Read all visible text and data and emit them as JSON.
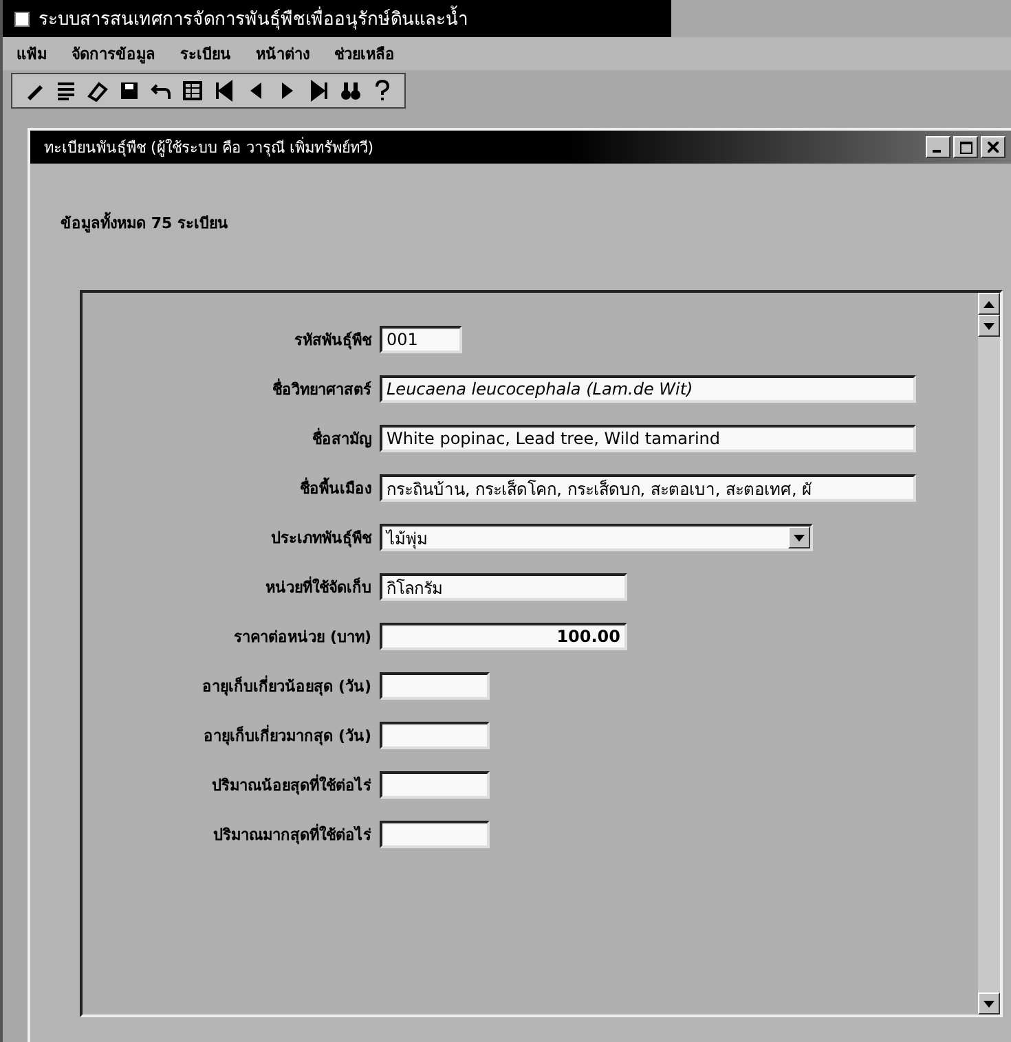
{
  "window": {
    "title": "ระบบสารสนเทศการจัดการพันธุ์พืชเพื่ออนุรักษ์ดินและน้ำ"
  },
  "menu": [
    "แฟ้ม",
    "จัดการข้อมูล",
    "ระเบียน",
    "หน้าต่าง",
    "ช่วยเหลือ"
  ],
  "child_window": {
    "title": "ทะเบียนพันธุ์พืช (ผู้ใช้ระบบ คือ วารุณี เพิ่มทรัพย์ทวี)",
    "record_count": "ข้อมูลทั้งหมด 75 ระเบียน",
    "fields": [
      {
        "label": "รหัสพันธุ์พืช",
        "kind": "text",
        "value": "001",
        "italic": false
      },
      {
        "label": "ชื่อวิทยาศาสตร์",
        "kind": "text",
        "value": "Leucaena leucocephala (Lam.de Wit)",
        "italic": true
      },
      {
        "label": "ชื่อสามัญ",
        "kind": "text",
        "value": "White popinac, Lead tree, Wild tamarind",
        "italic": false
      },
      {
        "label": "ชื่อพื้นเมือง",
        "kind": "text",
        "value": "กระถินบ้าน, กระเส็ดโคก, กระเส็ดบก, สะตอเบา, สะตอเทศ, ผั",
        "italic": false
      },
      {
        "label": "ประเภทพันธุ์พืช",
        "kind": "combo",
        "value": "ไม้พุ่ม",
        "italic": false
      },
      {
        "label": "หน่วยที่ใช้จัดเก็บ",
        "kind": "text",
        "value": "กิโลกรัม",
        "italic": false
      },
      {
        "label": "ราคาต่อหน่วย (บาท)",
        "kind": "number",
        "value": "100.00",
        "italic": false
      },
      {
        "label": "อายุเก็บเกี่ยวน้อยสุด (วัน)",
        "kind": "text"
      },
      {
        "label": "อายุเก็บเกี่ยวมากสุด (วัน)",
        "kind": "text"
      },
      {
        "label": "ปริมาณน้อยสุดที่ใช้ต่อไร่",
        "kind": "text"
      },
      {
        "label": "ปริมาณมากสุดที่ใช้ต่อไร่",
        "kind": "text"
      }
    ]
  }
}
